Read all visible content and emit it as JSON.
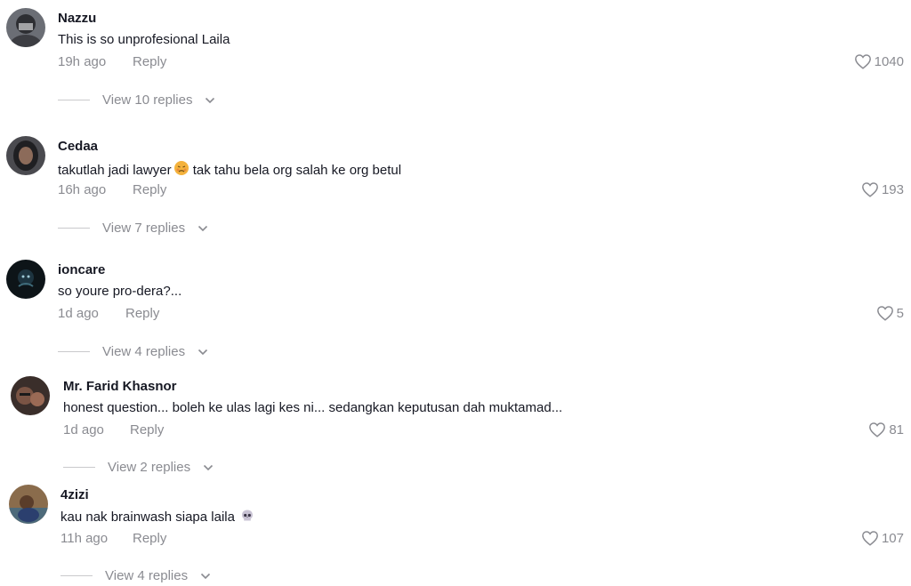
{
  "comments": [
    {
      "username": "Nazzu",
      "text": "This is so unprofesional Laila",
      "time": "19h ago",
      "reply_label": "Reply",
      "likes": "1040",
      "view_replies": "View 10 replies"
    },
    {
      "username": "Cedaa",
      "text": "takutlah jadi lawyer",
      "text_after_emoji": " tak tahu bela org salah ke org betul",
      "time": "16h ago",
      "reply_label": "Reply",
      "likes": "193",
      "view_replies": "View 7 replies"
    },
    {
      "username": "ioncare",
      "text": "so youre pro-dera?...",
      "time": "1d ago",
      "reply_label": "Reply",
      "likes": "5",
      "view_replies": "View 4 replies"
    },
    {
      "username": "Mr. Farid Khasnor",
      "text": "honest question... boleh ke ulas lagi kes ni... sedangkan keputusan dah muktamad...",
      "time": "1d ago",
      "reply_label": "Reply",
      "likes": "81",
      "view_replies": "View 2 replies"
    },
    {
      "username": "4zizi",
      "text": "kau nak brainwash siapa laila",
      "time": "11h ago",
      "reply_label": "Reply",
      "likes": "107",
      "view_replies": "View 4 replies"
    }
  ],
  "icons": {
    "like": "heart-outline-icon",
    "expand": "chevron-down-icon",
    "emoji_sad": "disappointed-face-emoji",
    "emoji_skull": "skull-emoji"
  },
  "colors": {
    "text": "#161823",
    "muted": "#8a8b91",
    "divider": "#c9c9cc"
  }
}
